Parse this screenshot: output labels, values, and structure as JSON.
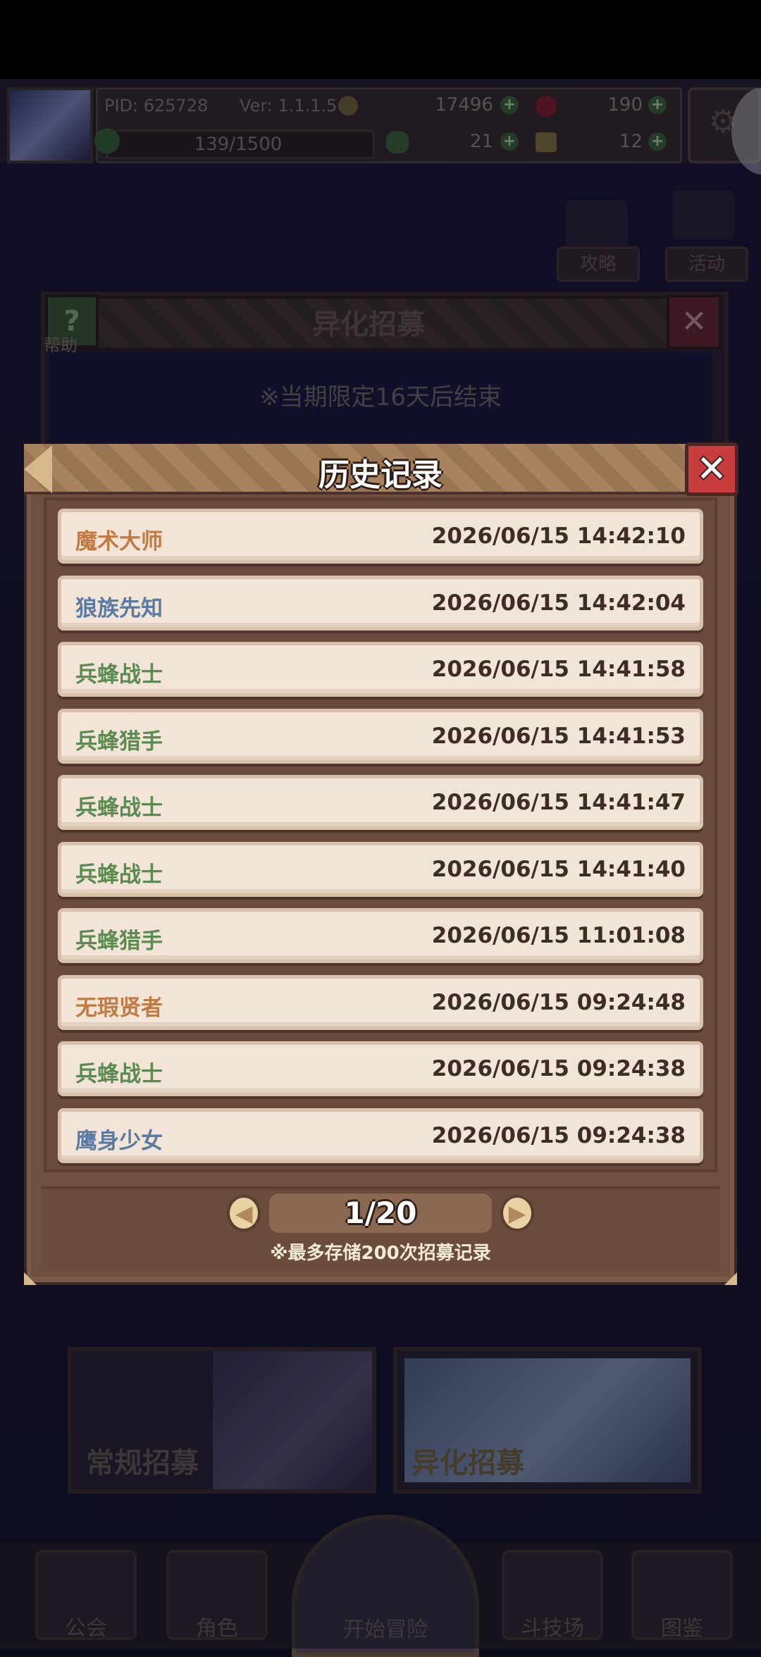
{
  "status": {
    "pid": "PID: 625728",
    "version": "Ver: 1.1.1.5",
    "gold": "17496",
    "gems": "190",
    "exp": "139/1500",
    "clover": "21",
    "keys": "12"
  },
  "shortcuts": {
    "guide": "攻略",
    "event": "活动"
  },
  "recruit": {
    "title": "异化招募",
    "help": "帮助",
    "notice": "※当期限定16天后结束",
    "pools": [
      "常规招募",
      "异化招募"
    ]
  },
  "history": {
    "title": "历史记录",
    "rows": [
      {
        "name": "魔术大师",
        "time": "2026/06/15 14:42:10",
        "rarity": "orange"
      },
      {
        "name": "狼族先知",
        "time": "2026/06/15 14:42:04",
        "rarity": "blue"
      },
      {
        "name": "兵蜂战士",
        "time": "2026/06/15 14:41:58",
        "rarity": "green"
      },
      {
        "name": "兵蜂猎手",
        "time": "2026/06/15 14:41:53",
        "rarity": "green"
      },
      {
        "name": "兵蜂战士",
        "time": "2026/06/15 14:41:47",
        "rarity": "green"
      },
      {
        "name": "兵蜂战士",
        "time": "2026/06/15 14:41:40",
        "rarity": "green"
      },
      {
        "name": "兵蜂猎手",
        "time": "2026/06/15 11:01:08",
        "rarity": "green"
      },
      {
        "name": "无瑕贤者",
        "time": "2026/06/15 09:24:48",
        "rarity": "orange"
      },
      {
        "name": "兵蜂战士",
        "time": "2026/06/15 09:24:38",
        "rarity": "green"
      },
      {
        "name": "鹰身少女",
        "time": "2026/06/15 09:24:38",
        "rarity": "blue"
      }
    ],
    "page": "1/20",
    "note": "※最多存储200次招募记录"
  },
  "nav": [
    "公会",
    "角色",
    "开始冒险",
    "斗技场",
    "图鉴"
  ],
  "colors": {
    "orange": "#c07a44",
    "blue": "#5a7aa4",
    "green": "#5b8b50",
    "close_red": "#c93c3e"
  }
}
